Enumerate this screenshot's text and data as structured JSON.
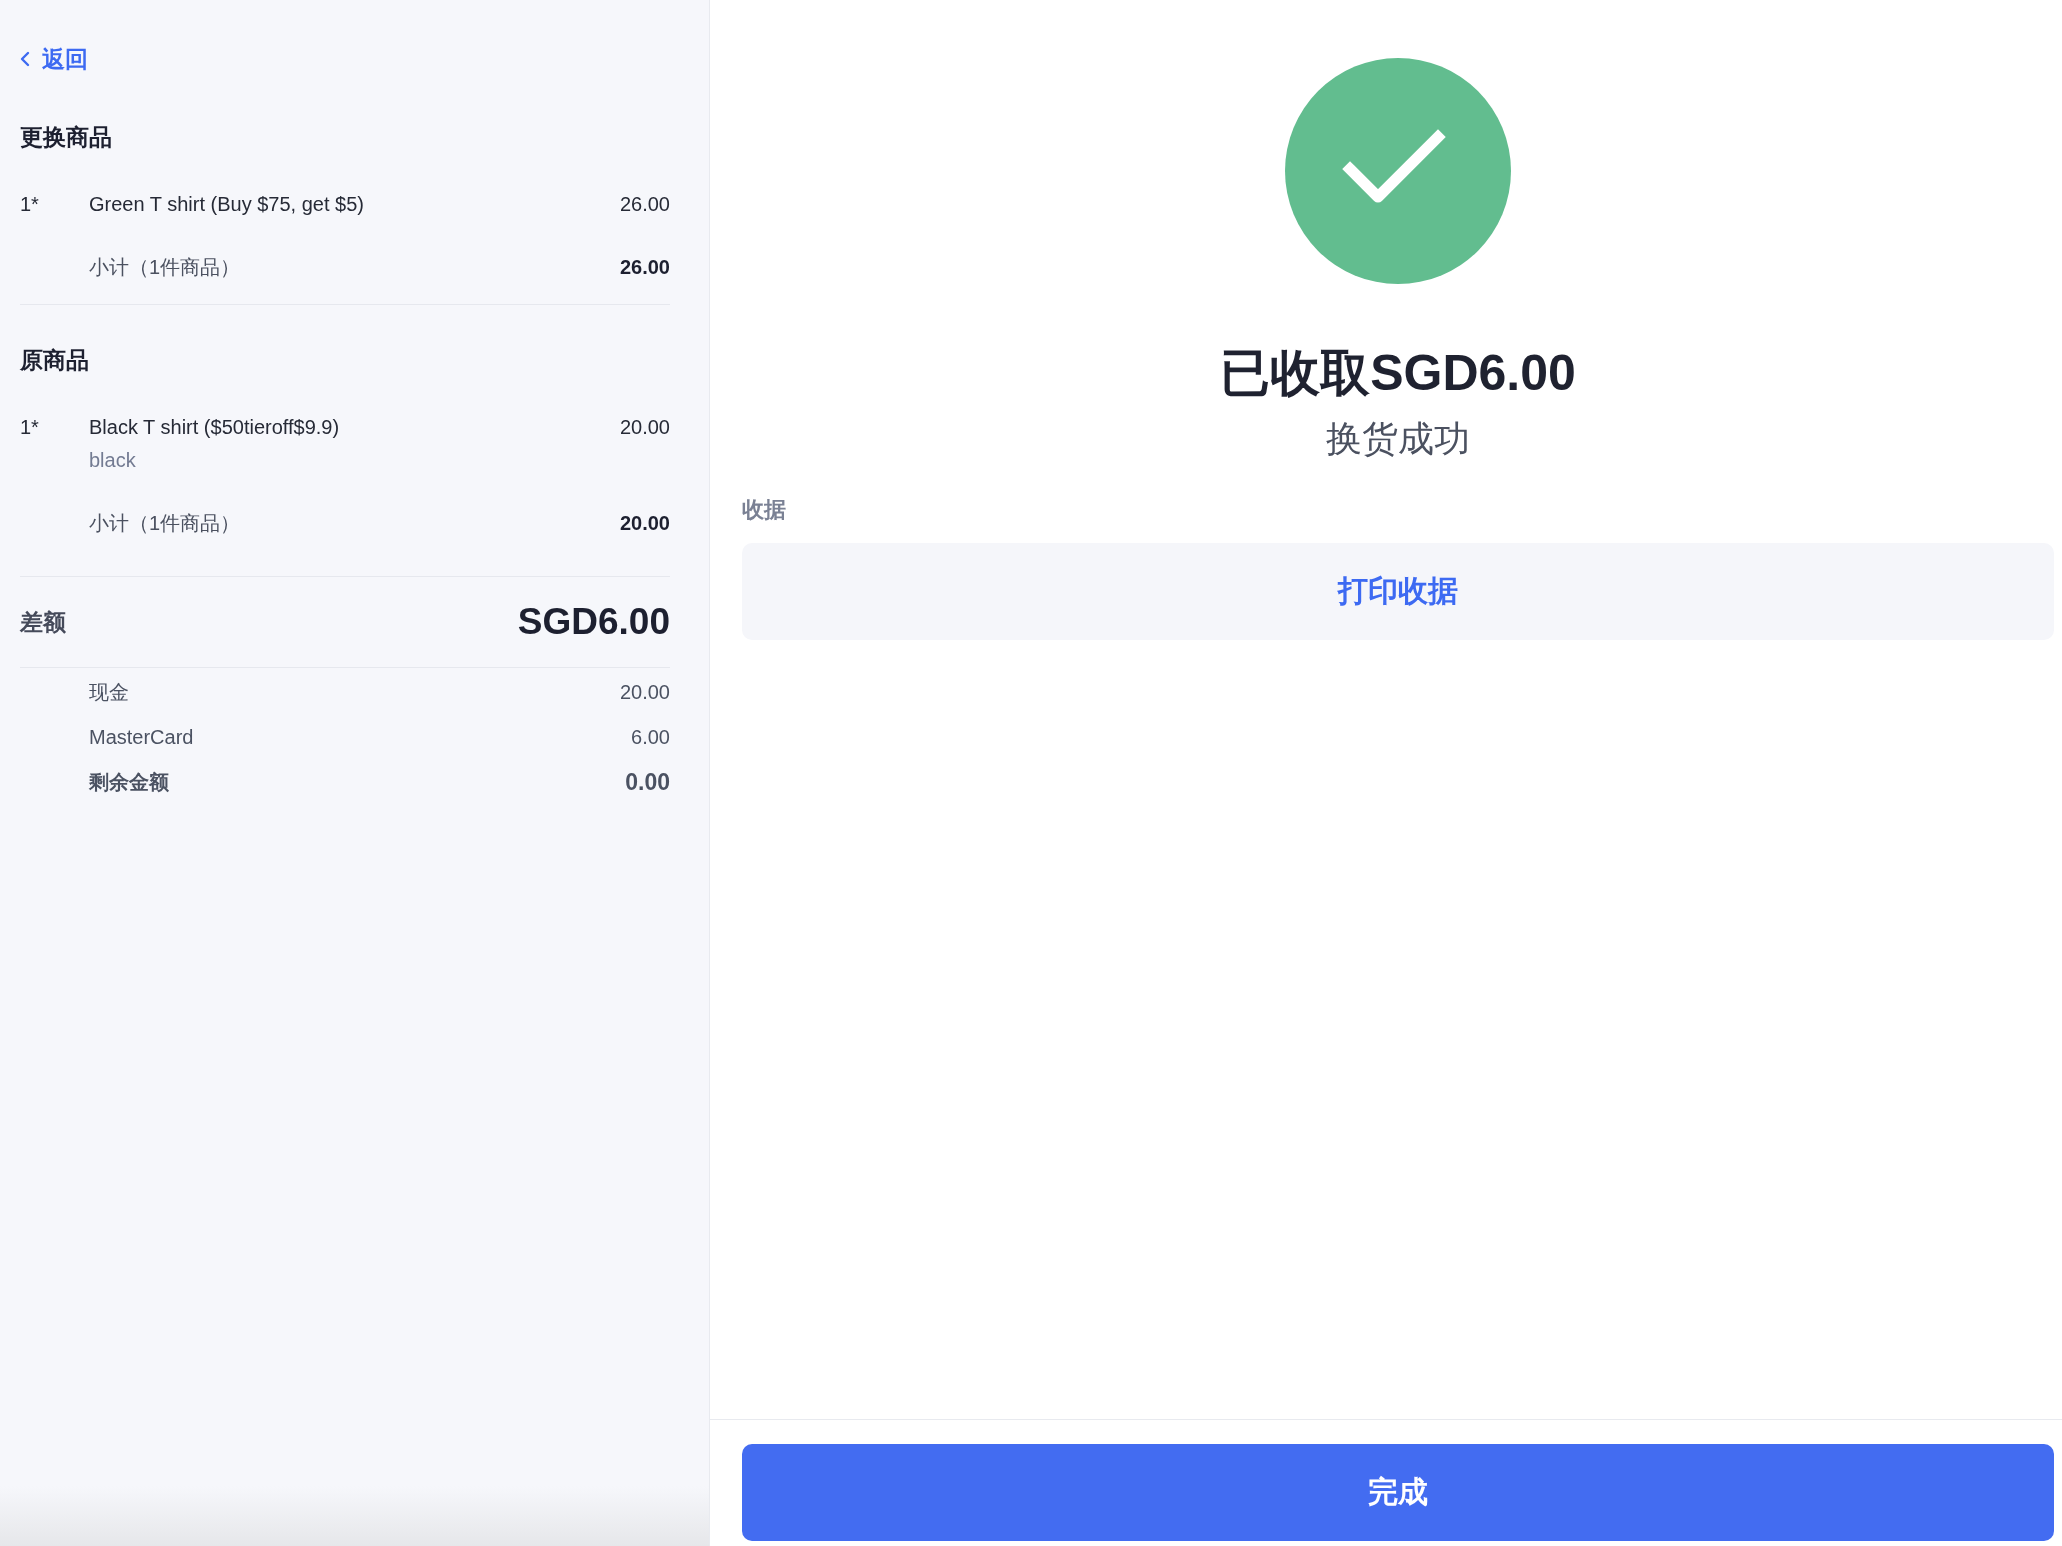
{
  "back_link": {
    "label": "返回"
  },
  "sections": [
    {
      "title": "更换商品",
      "items": [
        {
          "quantity": "1*",
          "name": "Green T shirt (Buy $75, get $5)",
          "price": "26.00"
        }
      ],
      "subtotal": {
        "label": "小计（1件商品）",
        "amount": "26.00"
      }
    },
    {
      "title": "原商品",
      "items": [
        {
          "quantity": "1*",
          "name": "Black T shirt ($50tieroff$9.9)",
          "variant": "black",
          "price": "20.00"
        }
      ],
      "subtotal": {
        "label": "小计（1件商品）",
        "amount": "20.00"
      }
    }
  ],
  "difference": {
    "label": "差额",
    "amount": "SGD6.00"
  },
  "payments": [
    {
      "kind": "method",
      "label": "现金",
      "amount": "20.00"
    },
    {
      "kind": "method",
      "label": "MasterCard",
      "amount": "6.00"
    },
    {
      "kind": "total",
      "label": "剩余金额",
      "amount": "0.00"
    }
  ],
  "result": {
    "title": "已收取SGD6.00",
    "subtitle": "换货成功"
  },
  "receipt": {
    "label": "收据",
    "print_button": "打印收据"
  },
  "done_button": "完成"
}
